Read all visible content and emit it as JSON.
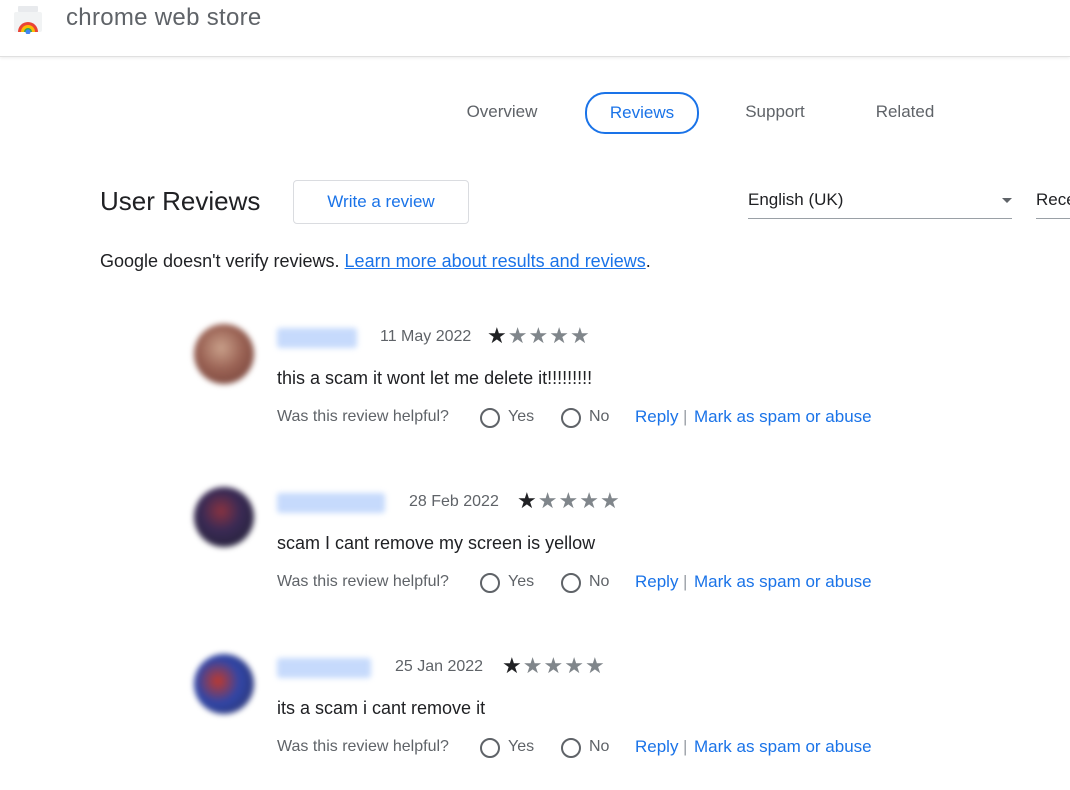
{
  "header": {
    "brand": "chrome web store",
    "logo_icon": "chrome-web-store-icon"
  },
  "tabs": [
    {
      "label": "Overview",
      "active": false
    },
    {
      "label": "Reviews",
      "active": true
    },
    {
      "label": "Support",
      "active": false
    },
    {
      "label": "Related",
      "active": false
    }
  ],
  "section": {
    "title": "User Reviews",
    "write_review": "Write a review",
    "language": "English (UK)",
    "sort": "Recent"
  },
  "disclaimer": {
    "text": "Google doesn't verify reviews. ",
    "link": "Learn more about results and reviews",
    "end": "."
  },
  "review_labels": {
    "helpful": "Was this review helpful?",
    "yes": "Yes",
    "no": "No",
    "reply": "Reply",
    "separator": "|",
    "spam": "Mark as spam or abuse"
  },
  "reviews": [
    {
      "date": "11 May 2022",
      "rating": 1,
      "text": "this a scam it wont let me delete it!!!!!!!!!"
    },
    {
      "date": "28 Feb 2022",
      "rating": 1,
      "text": "scam I cant remove my screen is yellow"
    },
    {
      "date": "25 Jan 2022",
      "rating": 1,
      "text": "its a scam i cant remove it"
    }
  ],
  "colors": {
    "accent": "#1a73e8",
    "text": "#202124",
    "muted": "#5f6368"
  }
}
